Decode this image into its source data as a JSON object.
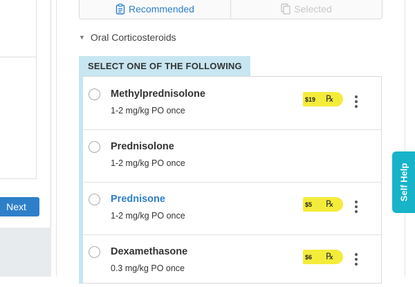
{
  "left_panel": {
    "next_label": "Next"
  },
  "tabs": [
    {
      "label": "Recommended",
      "icon": "clipboard-list-icon",
      "state": "active"
    },
    {
      "label": "Selected",
      "icon": "copy-icon",
      "state": "disabled"
    }
  ],
  "section": {
    "title": "Oral Corticosteroids",
    "expanded": true,
    "instruction": "SELECT ONE OF THE FOLLOWING"
  },
  "medications": [
    {
      "name": "Methylprednisolone",
      "dose": "1-2 mg/kg PO once",
      "price": "$19",
      "has_price": true,
      "highlighted": false
    },
    {
      "name": "Prednisolone",
      "dose": "1-2 mg/kg PO once",
      "price": "",
      "has_price": false,
      "highlighted": false
    },
    {
      "name": "Prednisone",
      "dose": "1-2 mg/kg PO once",
      "price": "$5",
      "has_price": true,
      "highlighted": true
    },
    {
      "name": "Dexamethasone",
      "dose": "0.3 mg/kg PO once",
      "price": "$6",
      "has_price": true,
      "highlighted": false
    }
  ],
  "rx_symbol": "℞",
  "self_help_label": "Self Help",
  "colors": {
    "accent": "#2e7fc9",
    "banner": "#c7e6f1",
    "price_tag": "#f4ec3b",
    "self_help": "#17b3c9"
  }
}
